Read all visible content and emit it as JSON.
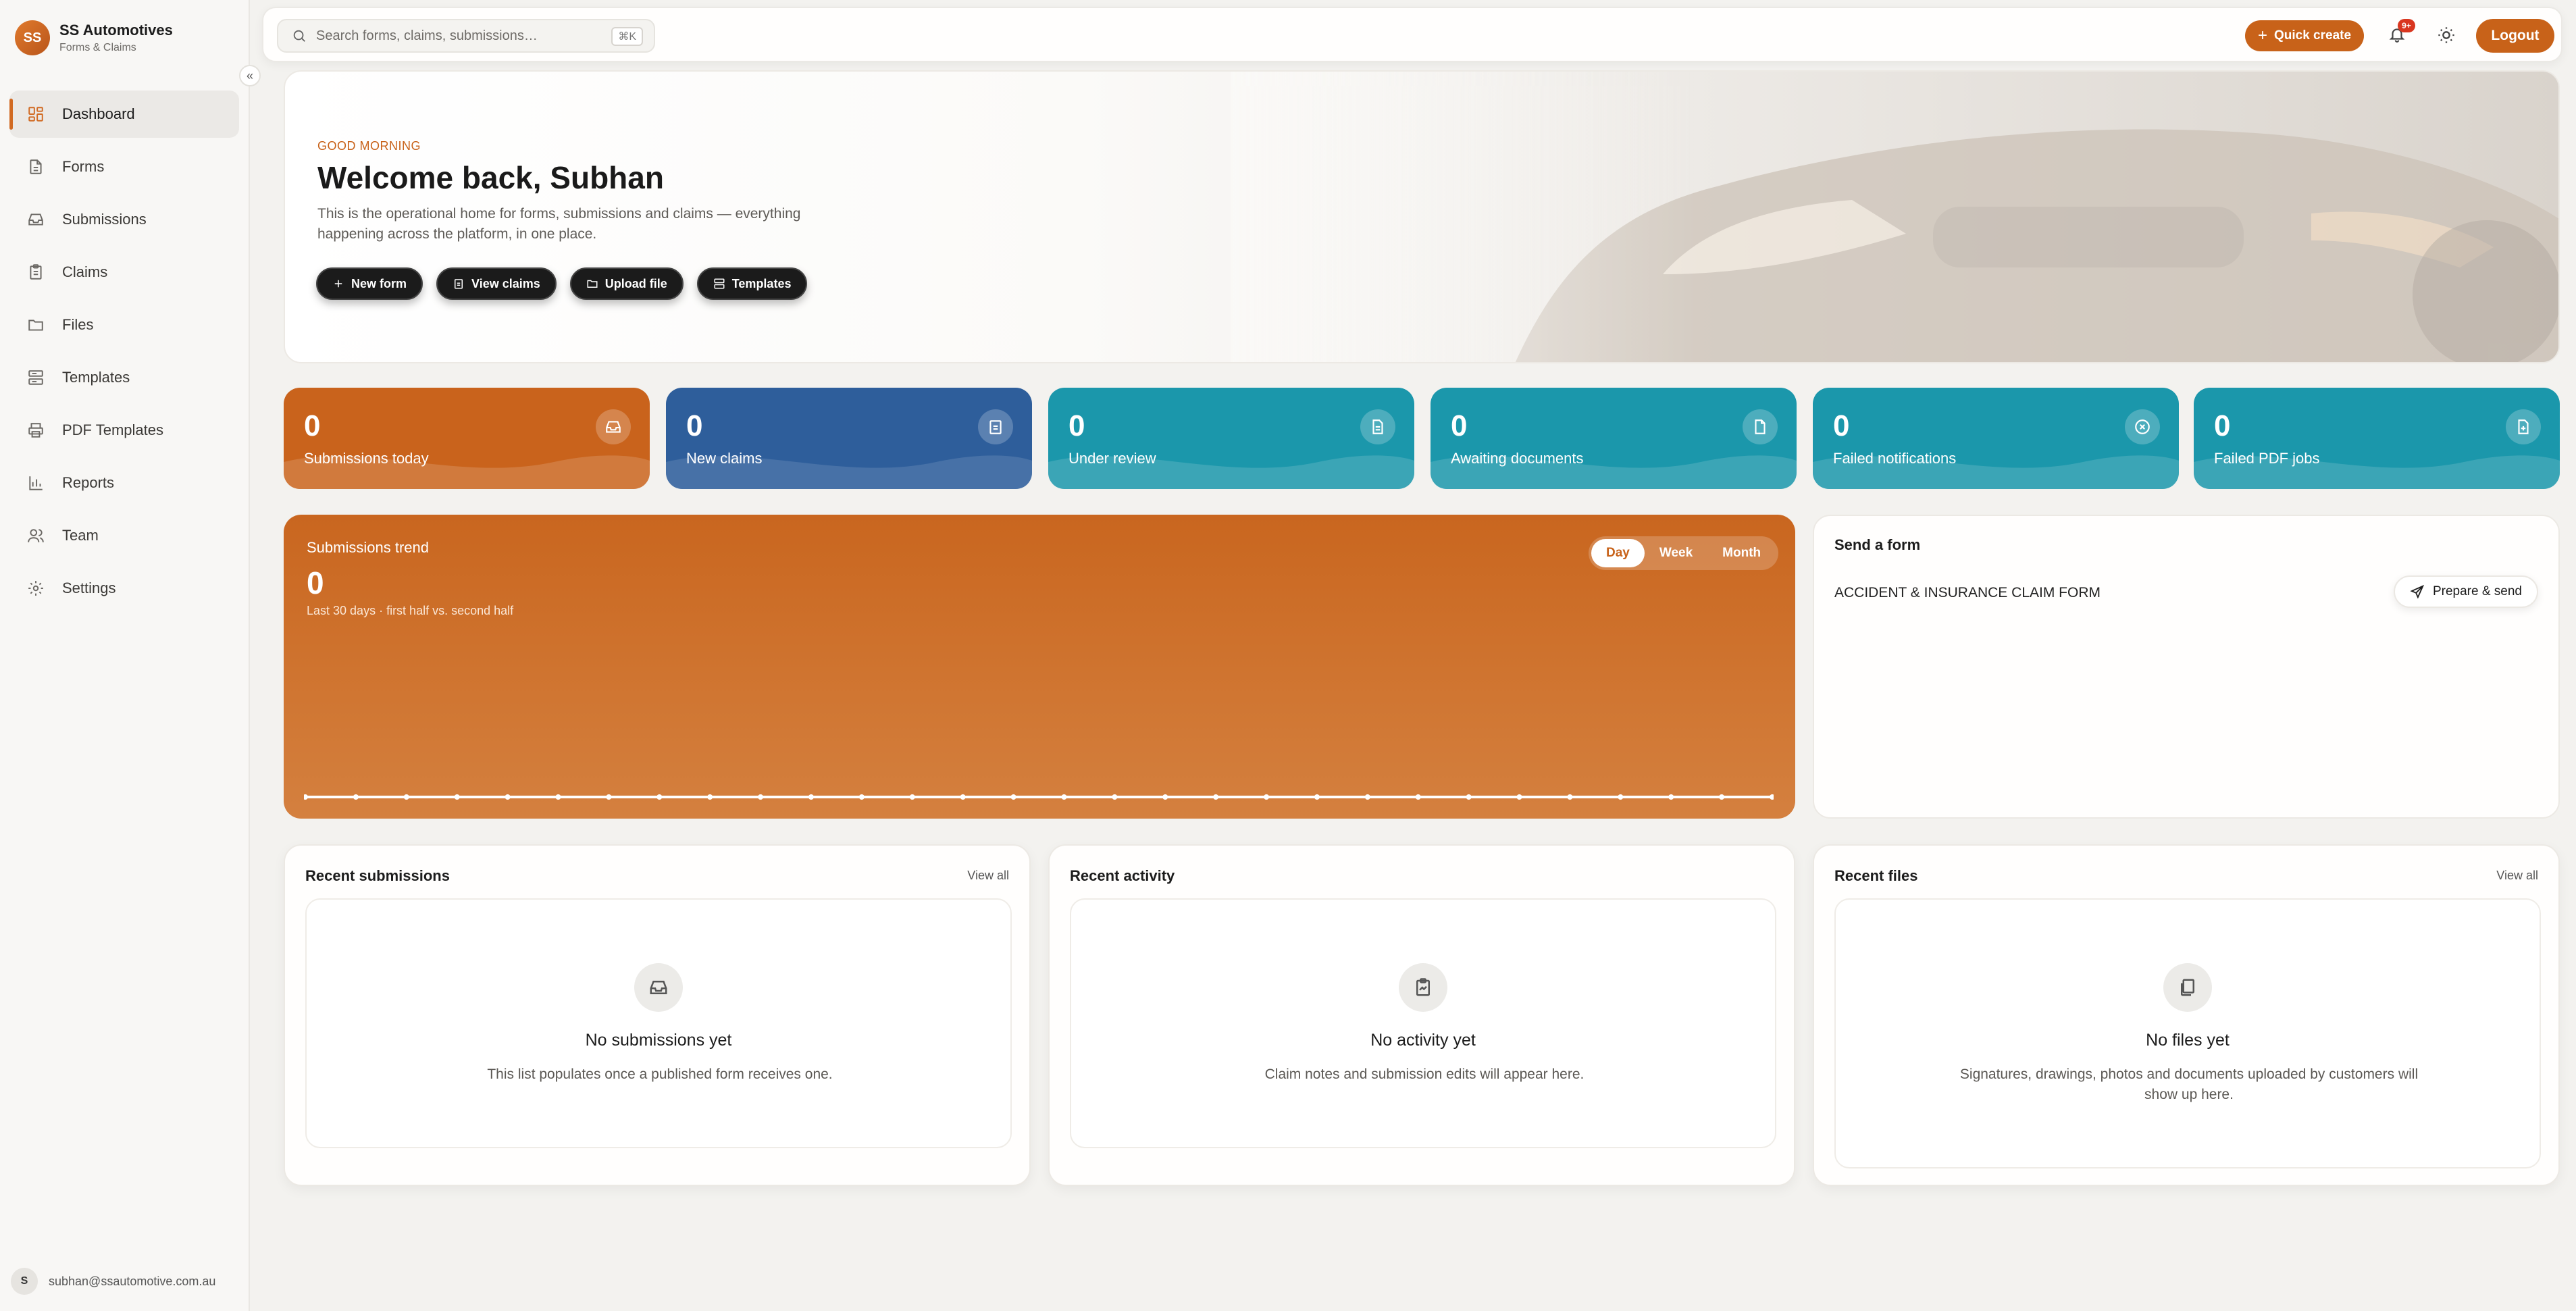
{
  "brand": {
    "initials": "SS",
    "name": "SS Automotives",
    "subtitle": "Forms & Claims"
  },
  "sidebar": {
    "collapse_icon": "chevrons-left-icon",
    "items": [
      {
        "label": "Dashboard",
        "icon": "dashboard-icon",
        "active": true
      },
      {
        "label": "Forms",
        "icon": "file-icon"
      },
      {
        "label": "Submissions",
        "icon": "inbox-icon"
      },
      {
        "label": "Claims",
        "icon": "clipboard-icon"
      },
      {
        "label": "Files",
        "icon": "folder-icon"
      },
      {
        "label": "Templates",
        "icon": "template-icon"
      },
      {
        "label": "PDF Templates",
        "icon": "printer-icon"
      },
      {
        "label": "Reports",
        "icon": "bar-chart-icon"
      },
      {
        "label": "Team",
        "icon": "users-icon"
      },
      {
        "label": "Settings",
        "icon": "gear-icon"
      }
    ],
    "user": {
      "initial": "S",
      "email": "subhan@ssautomotive.com.au"
    }
  },
  "topbar": {
    "search_placeholder": "Search forms, claims, submissions…",
    "search_shortcut": "⌘K",
    "quick_create": "Quick create",
    "notification_badge": "9+",
    "logout": "Logout"
  },
  "hero": {
    "greeting": "GOOD MORNING",
    "title": "Welcome back, Subhan",
    "description": "This is the operational home for forms, submissions and claims — everything happening across the platform, in one place.",
    "actions": [
      "New form",
      "View claims",
      "Upload file",
      "Templates"
    ]
  },
  "stats": [
    {
      "value": "0",
      "label": "Submissions today",
      "icon": "inbox-icon",
      "color": "#c9631c"
    },
    {
      "value": "0",
      "label": "New claims",
      "icon": "clipboard-icon",
      "color": "#2e5e9b"
    },
    {
      "value": "0",
      "label": "Under review",
      "icon": "document-icon",
      "color": "#1b97ab"
    },
    {
      "value": "0",
      "label": "Awaiting documents",
      "icon": "file-icon",
      "color": "#1b97ab"
    },
    {
      "value": "0",
      "label": "Failed notifications",
      "icon": "x-circle-icon",
      "color": "#1b97ab"
    },
    {
      "value": "0",
      "label": "Failed PDF jobs",
      "icon": "file-plus-icon",
      "color": "#1b97ab"
    }
  ],
  "trend": {
    "title": "Submissions trend",
    "value": "0",
    "subtitle": "Last 30 days · first half vs. second half",
    "ranges": [
      "Day",
      "Week",
      "Month"
    ],
    "active_range": "Day"
  },
  "chart_data": {
    "type": "line",
    "x": [
      1,
      2,
      3,
      4,
      5,
      6,
      7,
      8,
      9,
      10,
      11,
      12,
      13,
      14,
      15,
      16,
      17,
      18,
      19,
      20,
      21,
      22,
      23,
      24,
      25,
      26,
      27,
      28,
      29,
      30
    ],
    "series": [
      {
        "values": [
          0,
          0,
          0,
          0,
          0,
          0,
          0,
          0,
          0,
          0,
          0,
          0,
          0,
          0,
          0,
          0,
          0,
          0,
          0,
          0,
          0,
          0,
          0,
          0,
          0,
          0,
          0,
          0,
          0,
          0
        ]
      }
    ],
    "grid": false
  },
  "send_form": {
    "title": "Send a form",
    "form_name": "ACCIDENT & INSURANCE CLAIM FORM",
    "action": "Prepare & send"
  },
  "panels": [
    {
      "title": "Recent submissions",
      "link": "View all",
      "icon": "inbox-icon",
      "empty_title": "No submissions yet",
      "empty_desc": "This list populates once a published form receives one."
    },
    {
      "title": "Recent activity",
      "link": "",
      "icon": "clipboard-activity-icon",
      "empty_title": "No activity yet",
      "empty_desc": "Claim notes and submission edits will appear here."
    },
    {
      "title": "Recent files",
      "link": "View all",
      "icon": "files-icon",
      "empty_title": "No files yet",
      "empty_desc": "Signatures, drawings, photos and documents uploaded by customers will show up here."
    }
  ],
  "colors": {
    "accent": "#c86219",
    "teal": "#1b97ab",
    "blue": "#2e5e9b"
  }
}
